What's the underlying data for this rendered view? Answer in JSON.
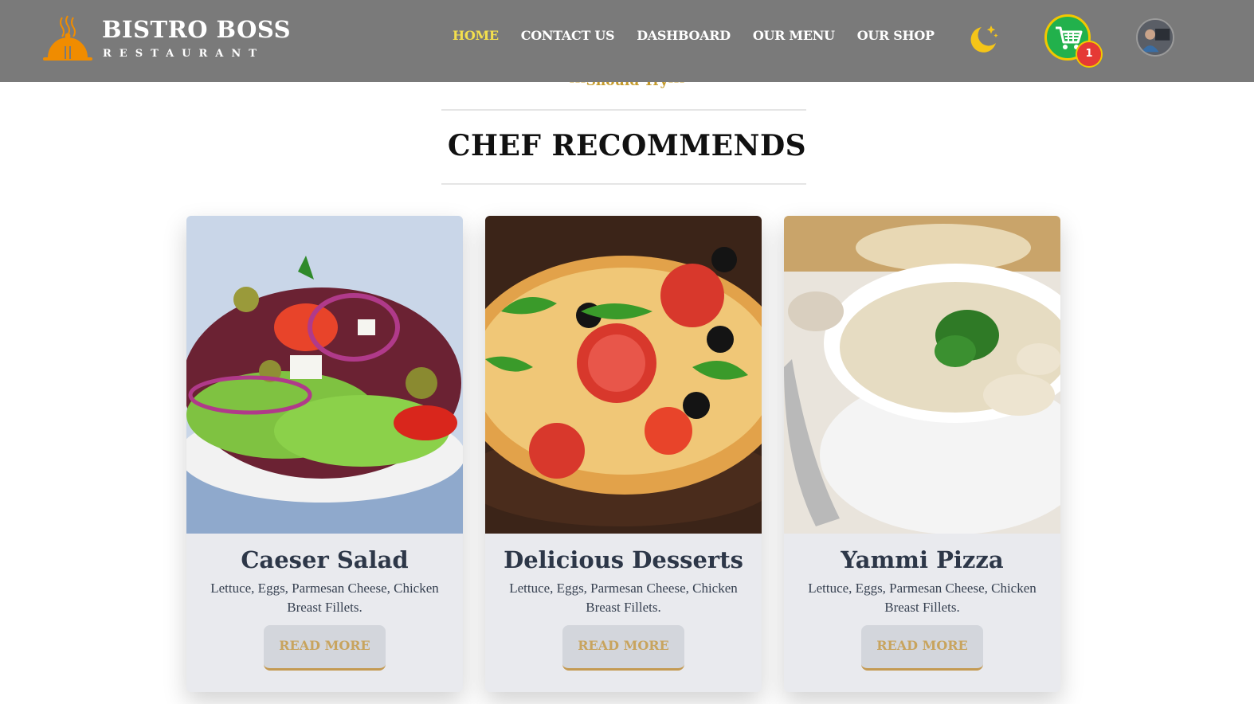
{
  "brand": {
    "name": "BISTRO BOSS",
    "tagline": "RESTAURANT"
  },
  "nav": {
    "items": [
      {
        "label": "HOME",
        "active": true
      },
      {
        "label": "CONTACT US",
        "active": false
      },
      {
        "label": "DASHBOARD",
        "active": false
      },
      {
        "label": "OUR MENU",
        "active": false
      },
      {
        "label": "OUR SHOP",
        "active": false
      }
    ],
    "cart_count": "1"
  },
  "section": {
    "subheading": "---Should Try---",
    "heading": "CHEF RECOMMENDS"
  },
  "cards": [
    {
      "title": "Caeser Salad",
      "description": "Lettuce, Eggs, Parmesan Cheese, Chicken Breast Fillets.",
      "button": "READ MORE",
      "image": "salad-image"
    },
    {
      "title": "Delicious Desserts",
      "description": "Lettuce, Eggs, Parmesan Cheese, Chicken Breast Fillets.",
      "button": "READ MORE",
      "image": "pizza-image"
    },
    {
      "title": "Yammi Pizza",
      "description": "Lettuce, Eggs, Parmesan Cheese, Chicken Breast Fillets.",
      "button": "READ MORE",
      "image": "soup-image"
    }
  ],
  "colors": {
    "navbar": "#7a7a7a",
    "accent": "#c49a2a",
    "active_nav": "#f4e04d",
    "card_bg": "#e9eaee",
    "cart_green": "#22b14c",
    "badge_red": "#e53935"
  }
}
